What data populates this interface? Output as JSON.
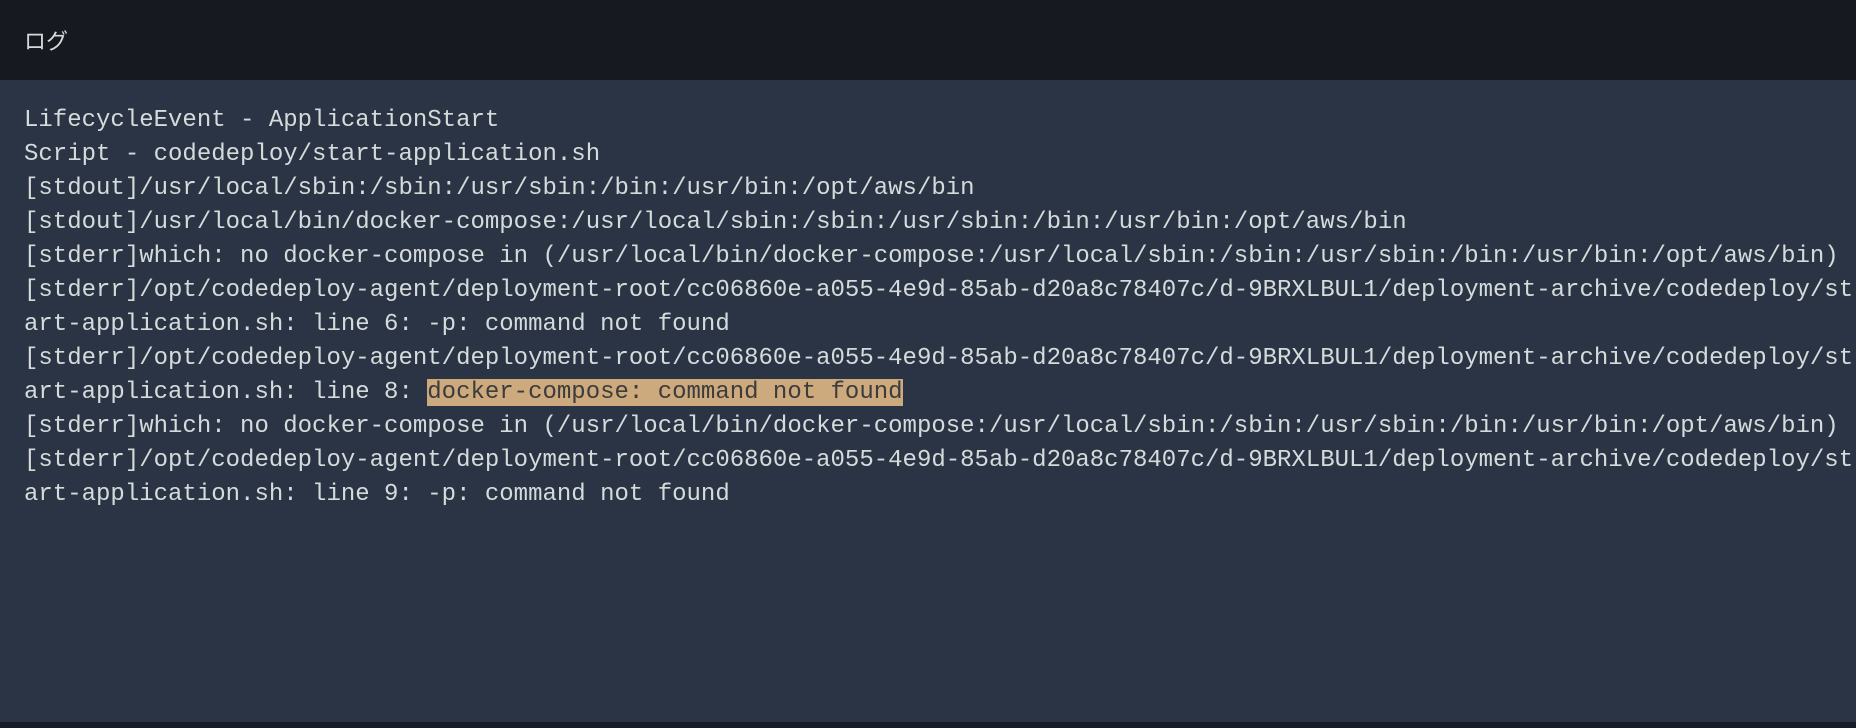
{
  "header": {
    "title": "ログ"
  },
  "log": {
    "lines": [
      {
        "text": "LifecycleEvent - ApplicationStart"
      },
      {
        "text": "Script - codedeploy/start-application.sh"
      },
      {
        "text": "[stdout]/usr/local/sbin:/sbin:/usr/sbin:/bin:/usr/bin:/opt/aws/bin"
      },
      {
        "text": "[stdout]/usr/local/bin/docker-compose:/usr/local/sbin:/sbin:/usr/sbin:/bin:/usr/bin:/opt/aws/bin"
      },
      {
        "text": "[stderr]which: no docker-compose in (/usr/local/bin/docker-compose:/usr/local/sbin:/sbin:/usr/sbin:/bin:/usr/bin:/opt/aws/bin)"
      },
      {
        "text": "[stderr]/opt/codedeploy-agent/deployment-root/cc06860e-a055-4e9d-85ab-d20a8c78407c/d-9BRXLBUL1/deployment-archive/codedeploy/start-application.sh: line 6: -p: command not found"
      },
      {
        "prefix": "[stderr]/opt/codedeploy-agent/deployment-root/cc06860e-a055-4e9d-85ab-d20a8c78407c/d-9BRXLBUL1/deployment-archive/codedeploy/start-application.sh: line 8: ",
        "highlighted": "docker-compose: command not found"
      },
      {
        "text": "[stderr]which: no docker-compose in (/usr/local/bin/docker-compose:/usr/local/sbin:/sbin:/usr/sbin:/bin:/usr/bin:/opt/aws/bin)"
      },
      {
        "text": "[stderr]/opt/codedeploy-agent/deployment-root/cc06860e-a055-4e9d-85ab-d20a8c78407c/d-9BRXLBUL1/deployment-archive/codedeploy/start-application.sh: line 9: -p: command not found"
      }
    ]
  }
}
